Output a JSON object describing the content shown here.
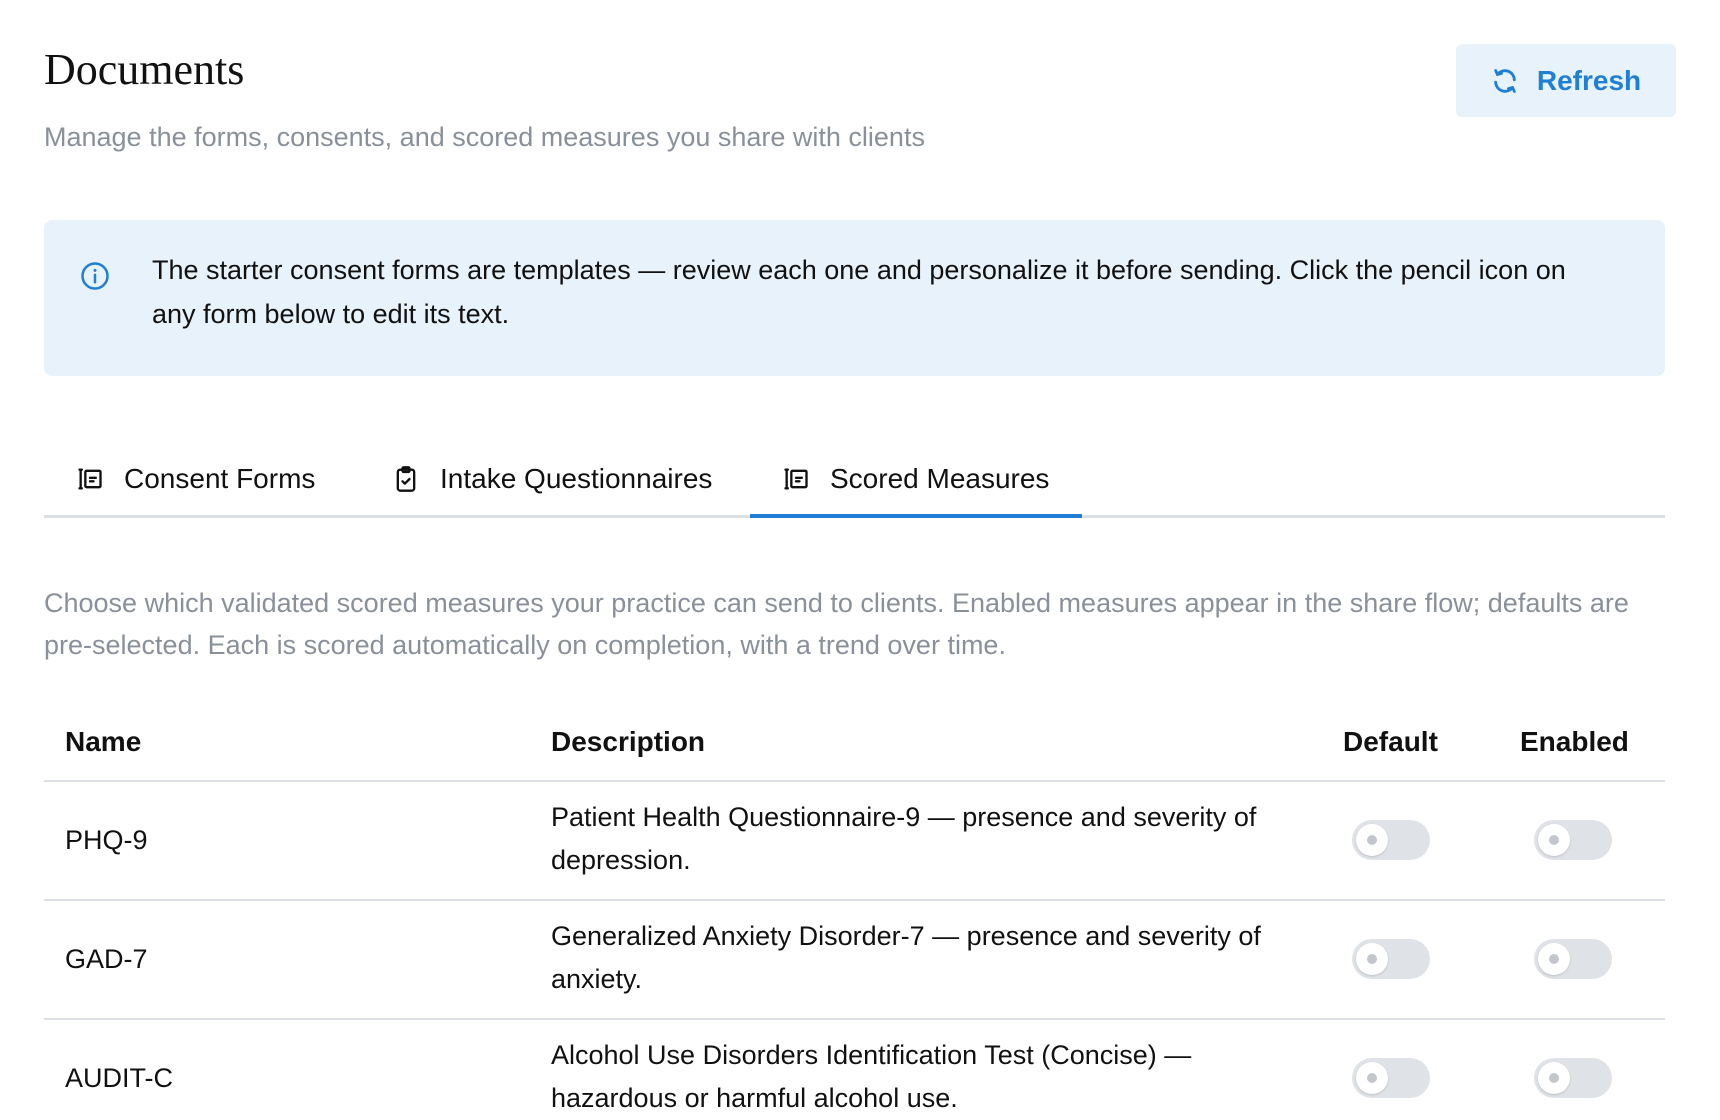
{
  "header": {
    "title": "Documents",
    "subtitle": "Manage the forms, consents, and scored measures you share with clients",
    "refresh_label": "Refresh"
  },
  "banner": {
    "icon": "info-icon",
    "text": "The starter consent forms are templates — review each one and personalize it before sending. Click the pencil icon on any form below to edit its text."
  },
  "tabs": [
    {
      "label": "Consent Forms",
      "icon": "form-icon",
      "active": false
    },
    {
      "label": "Intake Questionnaires",
      "icon": "clipboard-check-icon",
      "active": false
    },
    {
      "label": "Scored Measures",
      "icon": "form-icon",
      "active": true
    }
  ],
  "measures": {
    "intro": "Choose which validated scored measures your practice can send to clients. Enabled measures appear in the share flow; defaults are pre-selected. Each is scored automatically on completion, with a trend over time.",
    "columns": {
      "name": "Name",
      "description": "Description",
      "default": "Default",
      "enabled": "Enabled"
    },
    "rows": [
      {
        "name": "PHQ-9",
        "description": "Patient Health Questionnaire-9 — presence and severity of depression.",
        "default": false,
        "enabled": false
      },
      {
        "name": "GAD-7",
        "description": "Generalized Anxiety Disorder-7 — presence and severity of anxiety.",
        "default": false,
        "enabled": false
      },
      {
        "name": "AUDIT-C",
        "description": "Alcohol Use Disorders Identification Test (Concise) — hazardous or harmful alcohol use.",
        "default": false,
        "enabled": false
      }
    ]
  },
  "colors": {
    "accent": "#1f7fd4",
    "banner_bg": "#e8f2fb",
    "muted_text": "#8a9099",
    "divider": "#dcdfe3",
    "toggle_off": "#dfe2e6"
  }
}
